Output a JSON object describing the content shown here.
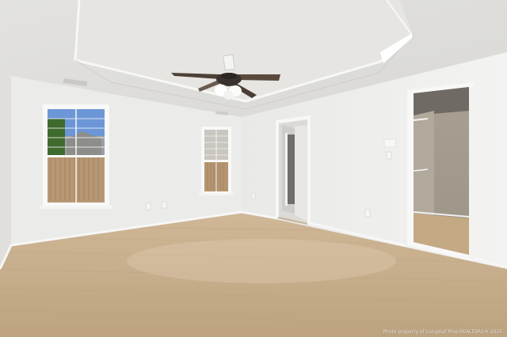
{
  "photo": {
    "watermark": "Photo property of Longleaf Pine REALTORS® 2025"
  },
  "colors": {
    "ceiling": "#e7e6e3",
    "wall": "#ebebea",
    "wall_shadow": "#dcdbd8",
    "floor": "#c4ac8c",
    "closet_wall": "#a59c8f",
    "fan_blade": "#5a4a3e",
    "sky": "#6c96d6"
  },
  "icons": [
    "ceiling-fan-icon"
  ]
}
